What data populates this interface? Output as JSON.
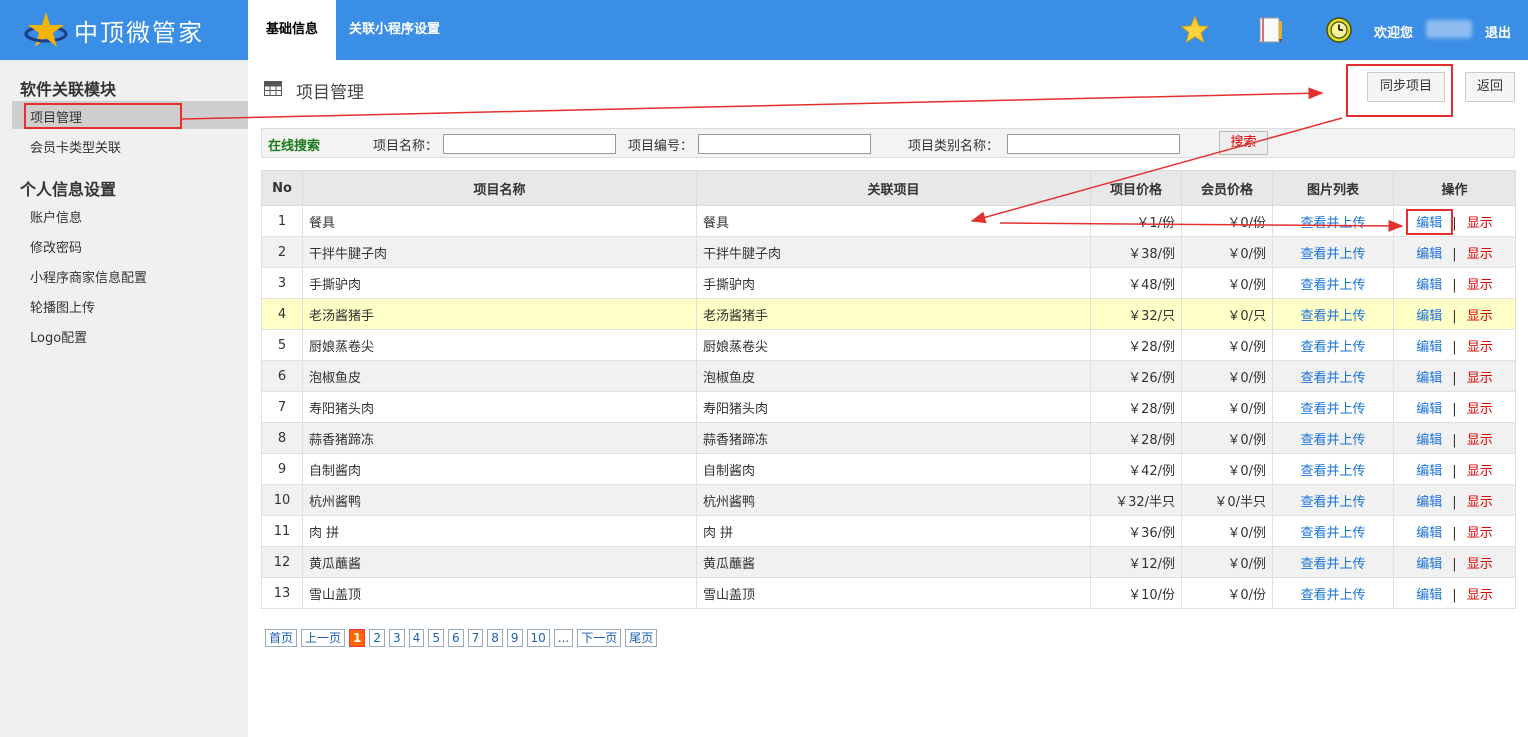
{
  "brand": {
    "name": "中顶微管家"
  },
  "tabs": [
    {
      "label": "基础信息",
      "active": true
    },
    {
      "label": "关联小程序设置",
      "active": false
    }
  ],
  "header": {
    "welcome": "欢迎您",
    "logout": "退出"
  },
  "sidebar": {
    "groups": [
      {
        "title": "软件关联模块",
        "items": [
          "项目管理",
          "会员卡类型关联"
        ]
      },
      {
        "title": "个人信息设置",
        "items": [
          "账户信息",
          "修改密码",
          "小程序商家信息配置",
          "轮播图上传",
          "Logo配置"
        ]
      }
    ],
    "active_item": "项目管理"
  },
  "page": {
    "title": "项目管理",
    "sync_button": "同步项目",
    "back_button": "返回"
  },
  "search": {
    "title": "在线搜索",
    "name_label": "项目名称：",
    "code_label": "项目编号：",
    "category_label": "项目类别名称：",
    "name_value": "",
    "code_value": "",
    "category_value": "",
    "button": "搜索"
  },
  "table": {
    "headers": [
      "No",
      "项目名称",
      "关联项目",
      "项目价格",
      "会员价格",
      "图片列表",
      "操作"
    ],
    "rows": [
      {
        "no": "1",
        "name": "餐具",
        "linked": "餐具",
        "price": "￥1/份",
        "member_price": "￥0/份"
      },
      {
        "no": "2",
        "name": "干拌牛腱子肉",
        "linked": "干拌牛腱子肉",
        "price": "￥38/例",
        "member_price": "￥0/例"
      },
      {
        "no": "3",
        "name": "手撕驴肉",
        "linked": "手撕驴肉",
        "price": "￥48/例",
        "member_price": "￥0/例"
      },
      {
        "no": "4",
        "name": "老汤酱猪手",
        "linked": "老汤酱猪手",
        "price": "￥32/只",
        "member_price": "￥0/只"
      },
      {
        "no": "5",
        "name": "厨娘蒸卷尖",
        "linked": "厨娘蒸卷尖",
        "price": "￥28/例",
        "member_price": "￥0/例"
      },
      {
        "no": "6",
        "name": "泡椒鱼皮",
        "linked": "泡椒鱼皮",
        "price": "￥26/例",
        "member_price": "￥0/例"
      },
      {
        "no": "7",
        "name": "寿阳猪头肉",
        "linked": "寿阳猪头肉",
        "price": "￥28/例",
        "member_price": "￥0/例"
      },
      {
        "no": "8",
        "name": "蒜香猪蹄冻",
        "linked": "蒜香猪蹄冻",
        "price": "￥28/例",
        "member_price": "￥0/例"
      },
      {
        "no": "9",
        "name": "自制酱肉",
        "linked": "自制酱肉",
        "price": "￥42/例",
        "member_price": "￥0/例"
      },
      {
        "no": "10",
        "name": "杭州酱鸭",
        "linked": "杭州酱鸭",
        "price": "￥32/半只",
        "member_price": "￥0/半只"
      },
      {
        "no": "11",
        "name": "肉 拼",
        "linked": "肉 拼",
        "price": "￥36/例",
        "member_price": "￥0/例"
      },
      {
        "no": "12",
        "name": "黄瓜蘸酱",
        "linked": "黄瓜蘸酱",
        "price": "￥12/例",
        "member_price": "￥0/例"
      },
      {
        "no": "13",
        "name": "雪山盖顶",
        "linked": "雪山盖顶",
        "price": "￥10/份",
        "member_price": "￥0/份"
      }
    ],
    "highlighted_row": 4,
    "image_link": "查看并上传",
    "edit_link": "编辑",
    "show_link": "显示",
    "separator": "|"
  },
  "pagination": {
    "first": "首页",
    "prev": "上一页",
    "pages": [
      "1",
      "2",
      "3",
      "4",
      "5",
      "6",
      "7",
      "8",
      "9",
      "10",
      "..."
    ],
    "current": "1",
    "next": "下一页",
    "last": "尾页"
  },
  "colors": {
    "topbar": "#3a8ee6",
    "sidebar": "#f0f0f0",
    "annotation": "#e53030",
    "link": "#1a73d9",
    "danger": "#dd0000",
    "highlight_row": "#ffffc8"
  },
  "icons": [
    "star-icon",
    "notebook-icon",
    "history-icon",
    "grid-icon"
  ]
}
